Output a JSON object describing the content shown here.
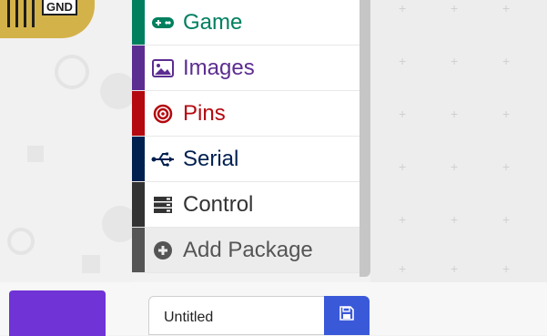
{
  "board": {
    "pin_label": "GND"
  },
  "toolbox": {
    "categories": [
      {
        "label": "Game",
        "color": "#007f5f",
        "icon": "gamepad-icon"
      },
      {
        "label": "Images",
        "color": "#5c2d91",
        "icon": "image-icon"
      },
      {
        "label": "Pins",
        "color": "#b4090f",
        "icon": "target-icon"
      },
      {
        "label": "Serial",
        "color": "#002050",
        "icon": "usb-icon"
      },
      {
        "label": "Control",
        "color": "#333333",
        "icon": "server-icon"
      }
    ],
    "add_package": {
      "label": "Add Package",
      "color": "#555555",
      "icon": "plus-circle-icon"
    }
  },
  "project": {
    "name": "Untitled"
  },
  "colors": {
    "download_button": "#6f33d6",
    "save_button": "#3a59d9"
  }
}
